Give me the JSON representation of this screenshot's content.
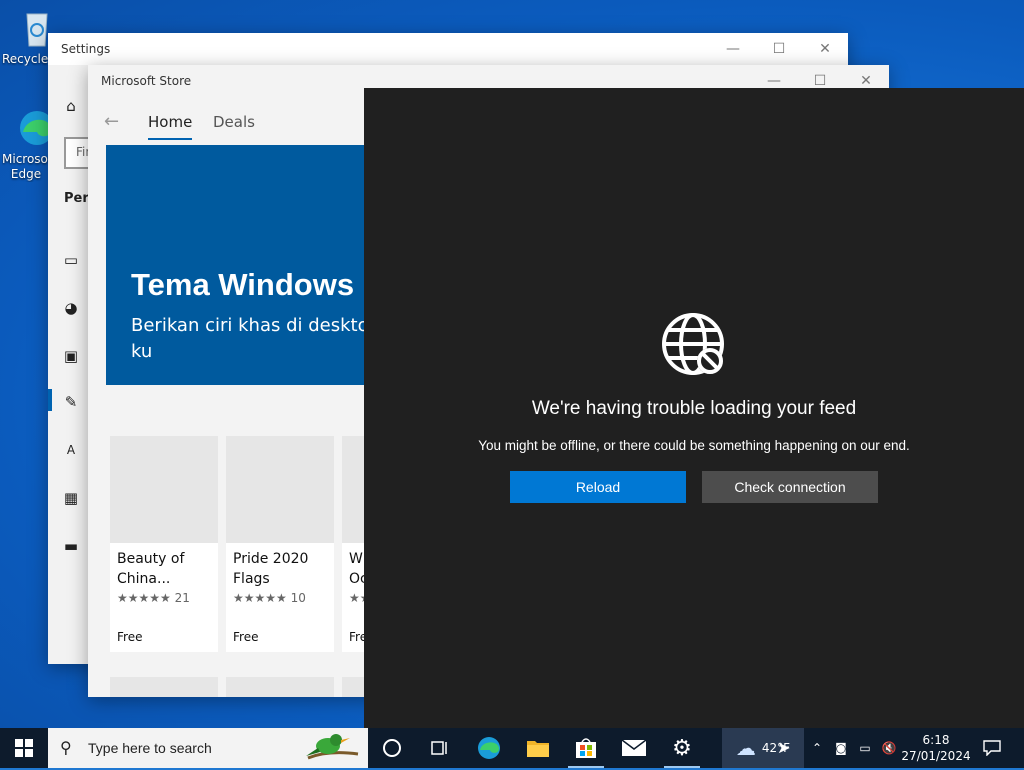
{
  "desktop": {
    "icons": [
      {
        "label": "Recycle Bin"
      },
      {
        "label": "Microsoft Edge"
      }
    ]
  },
  "settings": {
    "title": "Settings",
    "search_placeholder": "Find a setting",
    "section_heading": "Personalization"
  },
  "store": {
    "title": "Microsoft Store",
    "tabs": [
      "Home",
      "Deals"
    ],
    "hero": {
      "title": "Tema Windows",
      "subtitle": "Berikan ciri khas di desktop suara, warna aksen, dan ku"
    },
    "cards": [
      {
        "name": "Beauty of China...",
        "stars": "★★★★★",
        "count": "21",
        "price": "Free"
      },
      {
        "name": "Pride 2020 Flags",
        "stars": "★★★★★",
        "count": "10",
        "price": "Free"
      },
      {
        "name": "W Oc",
        "stars": "★★",
        "count": "",
        "price": "Fre"
      }
    ]
  },
  "feed": {
    "heading": "We're having trouble loading your feed",
    "message": "You might be offline, or there could be something happening on our end.",
    "reload_label": "Reload",
    "check_label": "Check connection",
    "accent": "#0078d4"
  },
  "taskbar": {
    "search_placeholder": "Type here to search",
    "weather": "42°F",
    "time": "6:18",
    "date": "27/01/2024"
  }
}
